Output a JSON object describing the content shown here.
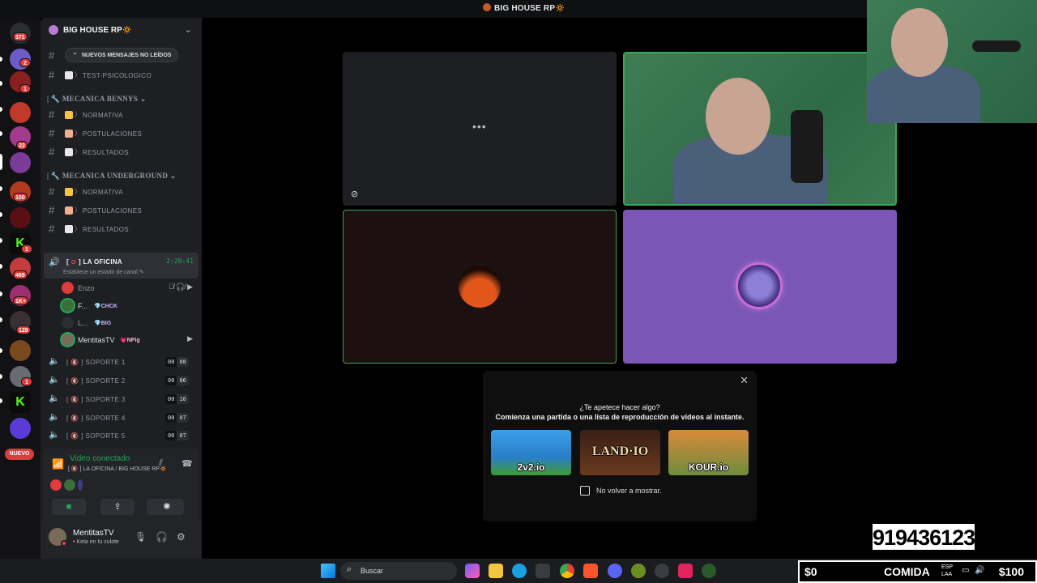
{
  "window": {
    "title": "BIG HOUSE RP🔅"
  },
  "rail": {
    "badges": [
      "371",
      "2",
      "1",
      "22",
      "100",
      "1",
      "489",
      "1K+",
      "129",
      "1"
    ],
    "new_label": "NUEVO"
  },
  "server": {
    "name": "BIG HOUSE RP🔅"
  },
  "unread_banner": "NUEVOS MENSAJES NO LEÍDOS",
  "channels": {
    "top": [
      {
        "label": "TEST-PSICOLOGICO"
      }
    ],
    "categories": [
      {
        "name": "MECANICA BENNYS",
        "items": [
          "NORMATIVA",
          "POSTULACIONES",
          "RESULTADOS"
        ]
      },
      {
        "name": "MECANICA UNDERGROUND",
        "items": [
          "NORMATIVA",
          "POSTULACIONES",
          "RESULTADOS"
        ]
      }
    ]
  },
  "active_voice": {
    "name": "LA OFICINA",
    "timer": "2:20:41",
    "status": "Establece un estado de canal",
    "members": [
      {
        "name": "Enzo",
        "tag": "",
        "tag_color": ""
      },
      {
        "name": "F...",
        "tag": "💎CHCK",
        "tag_color": "#c7b6ff"
      },
      {
        "name": "L...",
        "tag": "💎BIG",
        "tag_color": "#c7b6ff"
      },
      {
        "name": "MentitasTV",
        "tag": "💗NPig",
        "tag_color": "#ffb3d1"
      }
    ]
  },
  "support_channels": [
    {
      "label": "SOPORTE 1",
      "a": "00",
      "b": "08"
    },
    {
      "label": "SOPORTE 2",
      "a": "00",
      "b": "06"
    },
    {
      "label": "SOPORTE 3",
      "a": "00",
      "b": "10"
    },
    {
      "label": "SOPORTE 4",
      "a": "00",
      "b": "07"
    },
    {
      "label": "SOPORTE 5",
      "a": "00",
      "b": "07"
    }
  ],
  "voice_panel": {
    "title": "Video conectado",
    "subtitle": "LA OFICINA / BIG HOUSE RP🔅"
  },
  "user": {
    "name": "MentitasTV",
    "status": "• Keta en tu culote"
  },
  "activity": {
    "question": "¿Te apetece hacer algo?",
    "subtitle": "Comienza una partida o una lista de reproducción de vídeos al instante.",
    "games": [
      "2v2.io",
      "LAND·IO",
      "KOUR.io"
    ],
    "dont_show": "No volver a mostrar."
  },
  "overlay_number": "919436123",
  "taskbar": {
    "search_placeholder": "Buscar"
  },
  "hud": {
    "money_left": "$0",
    "food": "COMIDA",
    "lang_top": "ESP",
    "lang_bottom": "LAA",
    "money_right": "$100"
  },
  "colors": {
    "accent_green": "#23a55a",
    "badge_red": "#e03c3c",
    "tile_purple": "#7a57b6"
  }
}
